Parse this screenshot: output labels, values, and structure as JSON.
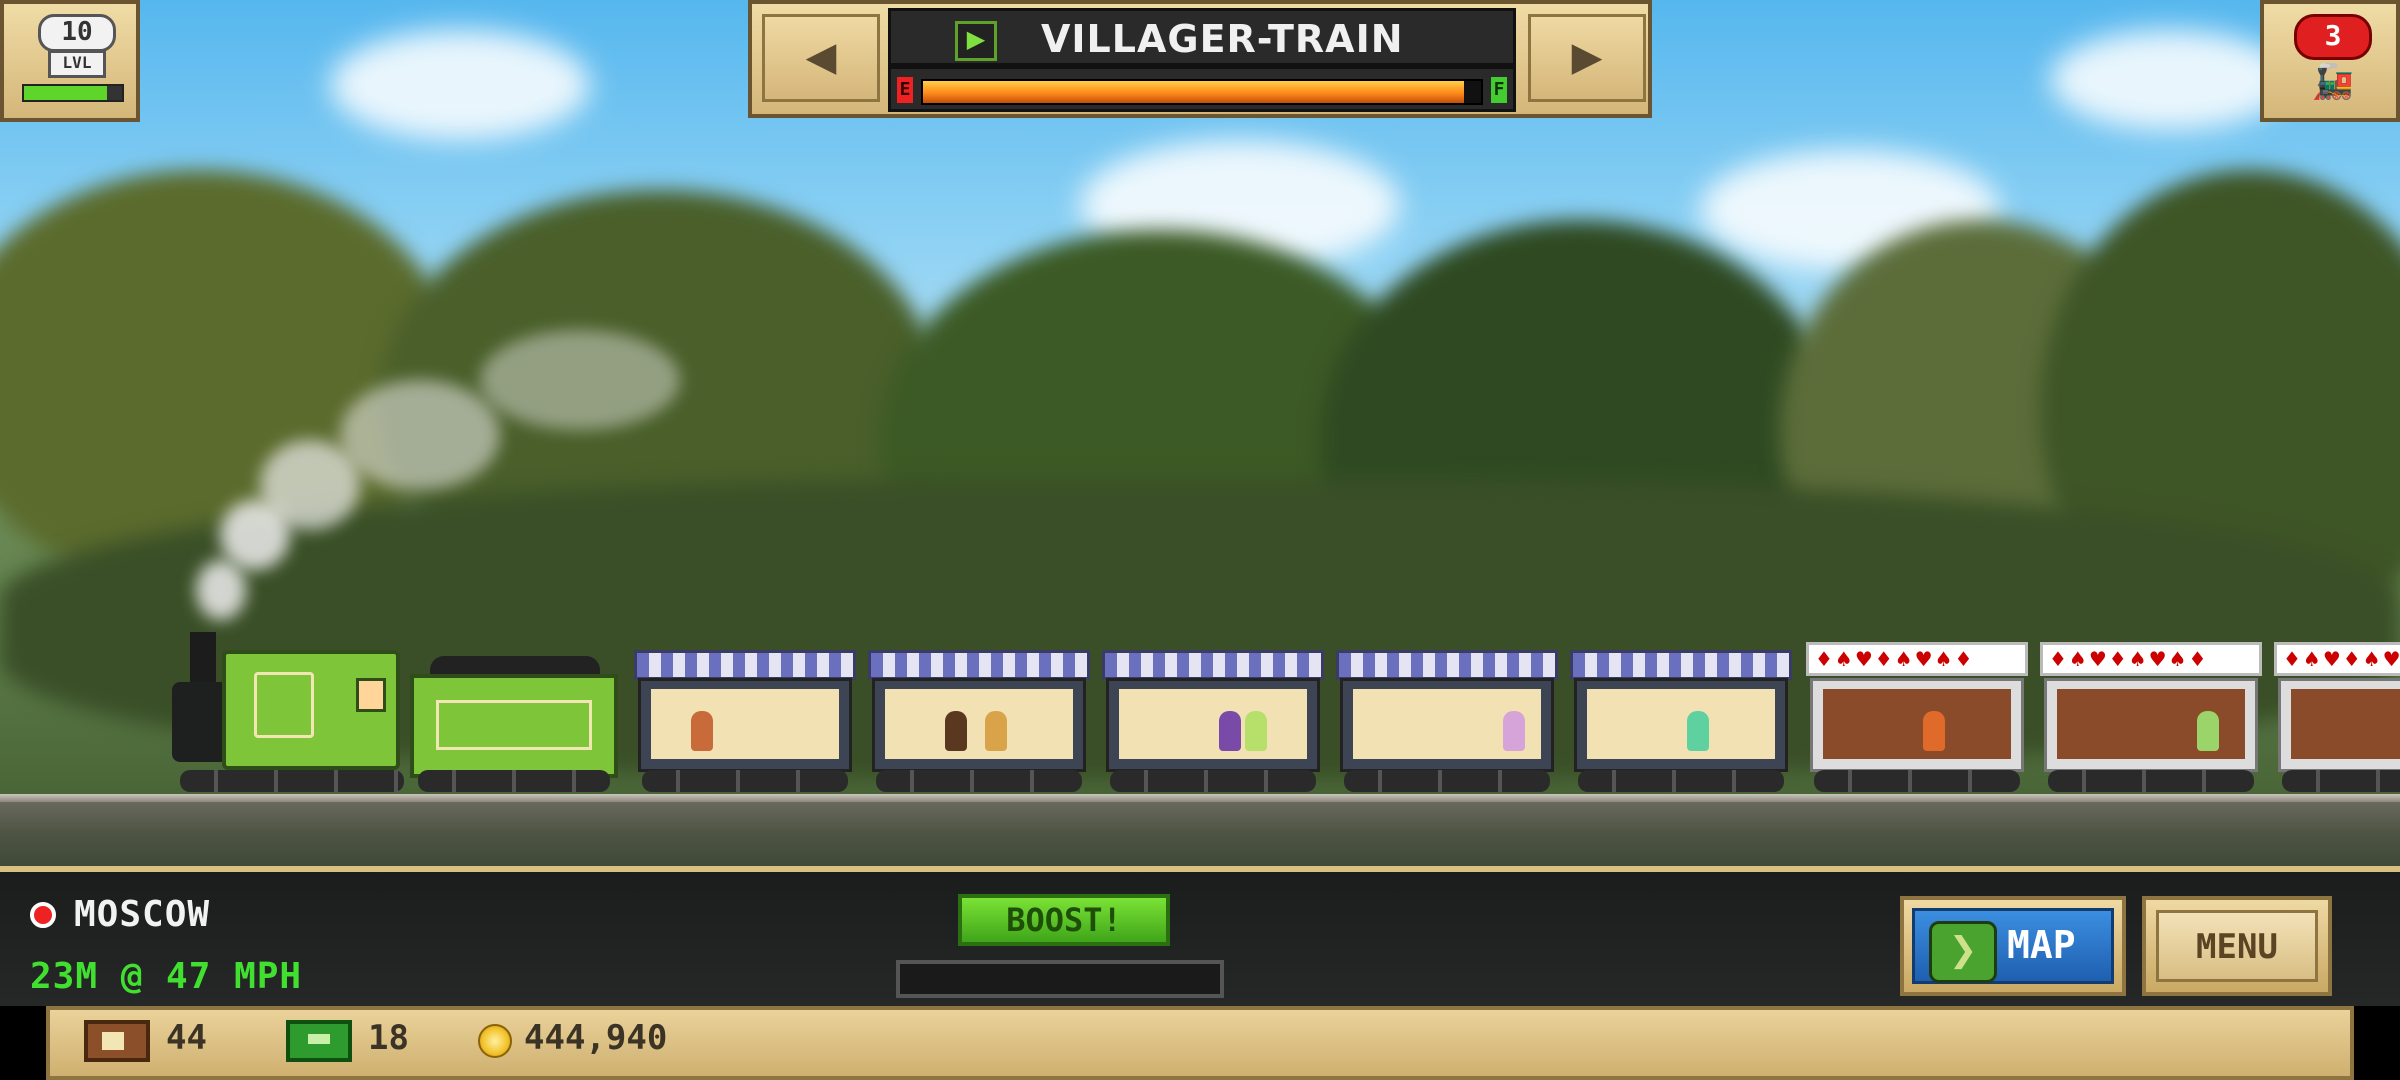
{
  "level": {
    "number": "10",
    "label": "LVL",
    "progress": 0.85
  },
  "train_selector": {
    "prev_icon": "arrow-left-icon",
    "next_icon": "arrow-right-icon",
    "train_icon": "train-flag-icon",
    "train_name": "VILLAGER-TRAIN",
    "fuel": {
      "empty_label": "E",
      "full_label": "F",
      "level": 0.97
    }
  },
  "trains_badge": {
    "count": "3",
    "icon": "train-icon"
  },
  "status": {
    "location": "MOSCOW",
    "location_icon": "location-dot-icon",
    "speed": "23M @ 47 MPH"
  },
  "boost": {
    "label": "BOOST!",
    "progress": 0
  },
  "buttons": {
    "map_label": "MAP",
    "map_icon": "map-icon",
    "menu_label": "MENU"
  },
  "resources": [
    {
      "icon": "crate-icon",
      "value": "44"
    },
    {
      "icon": "cash-icon",
      "value": "18"
    },
    {
      "icon": "coin-icon",
      "value": "444,940"
    }
  ],
  "colors": {
    "accent_green": "#41e030",
    "panel_tan": "#d4b679",
    "fuel_orange": "#ff8a1b",
    "map_blue": "#1f5fb0"
  }
}
